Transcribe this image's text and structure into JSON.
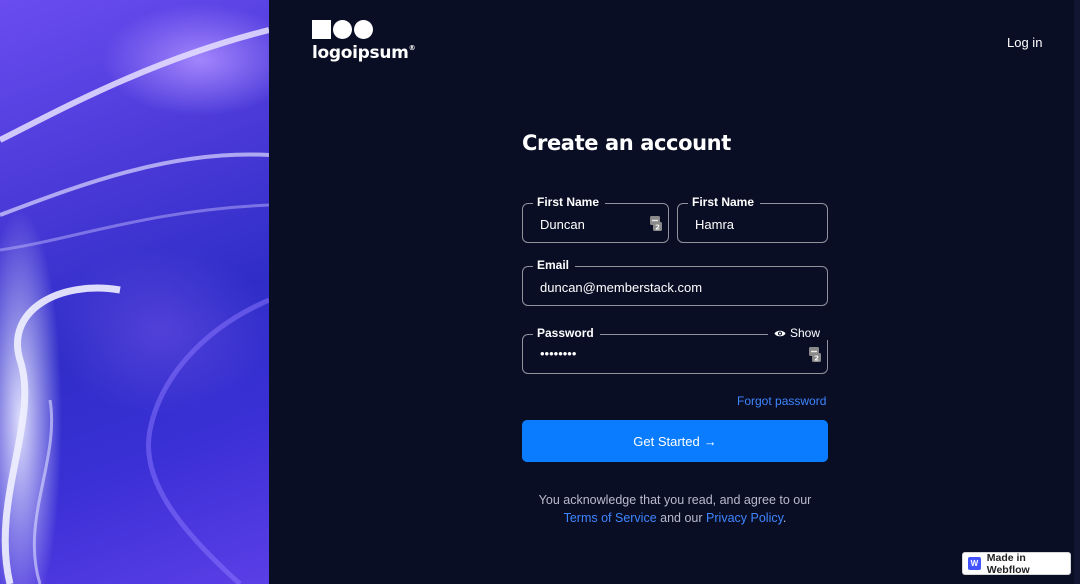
{
  "brand": {
    "name": "logoipsum",
    "mark": "®"
  },
  "header": {
    "login_label": "Log in"
  },
  "form": {
    "title": "Create an account",
    "first_name": {
      "label": "First Name",
      "value": "Duncan"
    },
    "last_name": {
      "label": "First Name",
      "value": "Hamra"
    },
    "email": {
      "label": "Email",
      "value": "duncan@memberstack.com"
    },
    "password": {
      "label": "Password",
      "value": "••••••••",
      "show_label": "Show"
    },
    "forgot_label": "Forgot password",
    "submit_label": "Get Started",
    "submit_arrow": "→"
  },
  "legal": {
    "line1": "You acknowledge that you read, and agree to our",
    "terms": "Terms of Service",
    "and": "and our",
    "privacy": "Privacy Policy",
    "end": "."
  },
  "badge": {
    "label": "Made in Webflow",
    "icon_letter": "W"
  },
  "colors": {
    "background": "#0a0e25",
    "accent": "#0a7cff",
    "link": "#3d86ff"
  }
}
